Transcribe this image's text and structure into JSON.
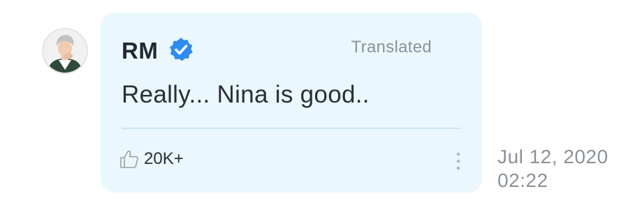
{
  "comment": {
    "author": "RM",
    "verified_icon": "verified-badge-icon",
    "translation_tag": "Translated",
    "text": "Really... Nina is good..",
    "like_icon": "thumbs-up-icon",
    "likes": "20K+",
    "more_icon": "more-vertical-icon",
    "date": "Jul 12, 2020",
    "time": "02:22"
  },
  "colors": {
    "bubble_background": "#eaf7fc",
    "divider": "#cde6f0",
    "verified_blue": "#2c8cf3",
    "muted_text": "#8c9299",
    "primary_text": "#2b2f36"
  }
}
